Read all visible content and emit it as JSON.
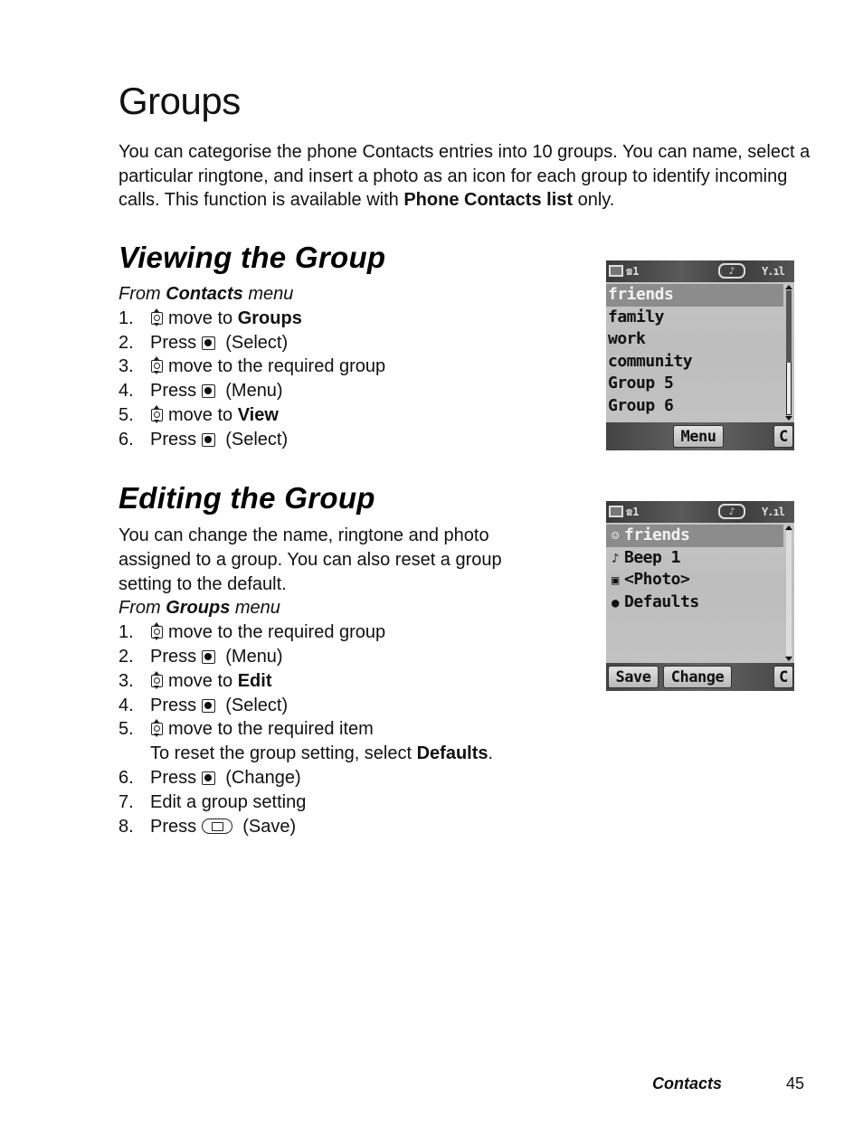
{
  "page": {
    "title": "Groups",
    "intro": {
      "text_before": "You can categorise the phone Contacts entries into 10 groups. You can name, select a particular ringtone, and insert a photo as an icon for each group to identify incoming calls. This function is available with ",
      "bold": "Phone Contacts list",
      "text_after": " only."
    }
  },
  "viewing": {
    "title": "Viewing the Group",
    "from": {
      "prefix": "From ",
      "bold": "Contacts",
      "suffix": " menu"
    },
    "steps": [
      {
        "num": "1.",
        "icon": "navigation-key-icon",
        "text": "move to ",
        "bold": "Groups",
        "after": ""
      },
      {
        "num": "2.",
        "icon": "select-key-icon",
        "text": "Press ",
        "after": " (Select)"
      },
      {
        "num": "3.",
        "icon": "navigation-key-icon",
        "text": "move to the required group"
      },
      {
        "num": "4.",
        "icon": "select-key-icon",
        "text": "Press ",
        "after": " (Menu)"
      },
      {
        "num": "5.",
        "icon": "navigation-key-icon",
        "text": "move to ",
        "bold": "View"
      },
      {
        "num": "6.",
        "icon": "select-key-icon",
        "text": "Press ",
        "after": " (Select)"
      }
    ],
    "screen": {
      "items": [
        "friends",
        "family",
        "work",
        "community",
        "Group 5",
        "Group 6"
      ],
      "highlighted": 0,
      "softkeys": {
        "center": "Menu",
        "right": "C"
      }
    }
  },
  "editing": {
    "title": "Editing the Group",
    "description": "You can change the name, ringtone and photo assigned to a group. You can also reset a group setting to the default.",
    "from": {
      "prefix": "From ",
      "bold": "Groups",
      "suffix": " menu"
    },
    "steps": [
      {
        "num": "1.",
        "icon": "navigation-key-icon",
        "text": "move to the required group"
      },
      {
        "num": "2.",
        "icon": "select-key-icon",
        "text": "Press ",
        "after": " (Menu)"
      },
      {
        "num": "3.",
        "icon": "navigation-key-icon",
        "text": "move to ",
        "bold": "Edit"
      },
      {
        "num": "4.",
        "icon": "select-key-icon",
        "text": "Press ",
        "after": " (Select)"
      },
      {
        "num": "5.",
        "icon": "navigation-key-icon",
        "text": "move to the required item",
        "note": {
          "text": "To reset the group setting, select ",
          "bold": "Defaults",
          "after": "."
        }
      },
      {
        "num": "6.",
        "icon": "select-key-icon",
        "text": "Press ",
        "after": " (Change)"
      },
      {
        "num": "7.",
        "text": "Edit a group setting"
      },
      {
        "num": "8.",
        "icon": "soft-key-icon",
        "text": "Press ",
        "after": " (Save)"
      }
    ],
    "screen": {
      "items": [
        {
          "icon": "person-icon",
          "glyph": "☺",
          "label": "friends"
        },
        {
          "icon": "music-note-icon",
          "glyph": "♪",
          "label": "Beep 1"
        },
        {
          "icon": "photo-icon",
          "glyph": "▣",
          "label": "<Photo>"
        },
        {
          "icon": "defaults-circle-icon",
          "glyph": "●",
          "label": "Defaults"
        }
      ],
      "highlighted": 0,
      "softkeys": {
        "left": "Save",
        "center": "Change",
        "right": "C"
      }
    }
  },
  "status_bar": {
    "line_glyph": "☎1",
    "ring_glyph": "♪",
    "signal_glyph": "Y.ıl"
  },
  "footer": {
    "section": "Contacts",
    "page_number": "45"
  }
}
